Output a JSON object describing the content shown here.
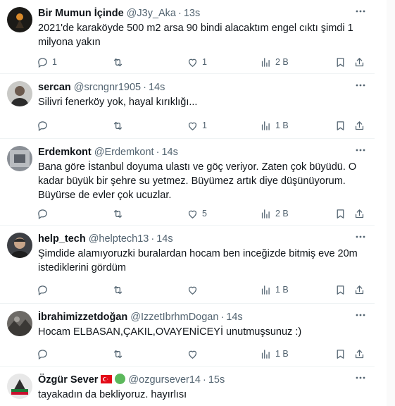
{
  "colors": {
    "text": "#0f1419",
    "secondary": "#536471",
    "divider": "#eff3f4",
    "background": "#ffffff"
  },
  "icons": {
    "reply": "reply-icon",
    "retweet": "retweet-icon",
    "like": "like-icon",
    "views": "views-icon",
    "bookmark": "bookmark-icon",
    "share": "share-icon",
    "more": "more-icon"
  },
  "tweets": [
    {
      "name": "Bir Mumun İçinde",
      "handle": "@J3y_Aka",
      "time": "13s",
      "text": "2021'de karaköyde 500 m2 arsa 90 bindi alacaktım engel cıktı şimdi 1 milyona yakın",
      "replies": "1",
      "retweets": "",
      "likes": "1",
      "views": "2 B"
    },
    {
      "name": "sercan",
      "handle": "@srcngnr1905",
      "time": "14s",
      "text": "Silivri fenerköy yok, hayal kırıklığı...",
      "replies": "",
      "retweets": "",
      "likes": "1",
      "views": "1 B"
    },
    {
      "name": "Erdemkont",
      "handle": "@Erdemkont",
      "time": "14s",
      "text": "Bana göre İstanbul doyuma ulastı ve göç veriyor. Zaten çok büyüdü. O kadar büyük bir şehre su yetmez. Büyümez artık diye düşünüyorum. Büyürse de evler çok ucuzlar.",
      "replies": "",
      "retweets": "",
      "likes": "5",
      "views": "2 B"
    },
    {
      "name": "help_tech",
      "handle": "@helptech13",
      "time": "14s",
      "text": "Şimdide alamıyoruzki buralardan hocam ben inceğizde bitmiş eve 20m istediklerini gördüm",
      "replies": "",
      "retweets": "",
      "likes": "",
      "views": "1 B"
    },
    {
      "name": "İbrahimizzetdoğan",
      "handle": "@IzzetIbrhmDogan",
      "time": "14s",
      "text": "Hocam ELBASAN,ÇAKIL,OVAYENİCEYİ unutmuşsunuz :)",
      "replies": "",
      "retweets": "",
      "likes": "",
      "views": "1 B"
    },
    {
      "name": "Özgür Sever",
      "handle": "@ozgursever14",
      "time": "15s",
      "text": "tayakadın da bekliyoruz. hayırlısı",
      "replies": "",
      "retweets": "",
      "likes": "",
      "views": ""
    }
  ]
}
